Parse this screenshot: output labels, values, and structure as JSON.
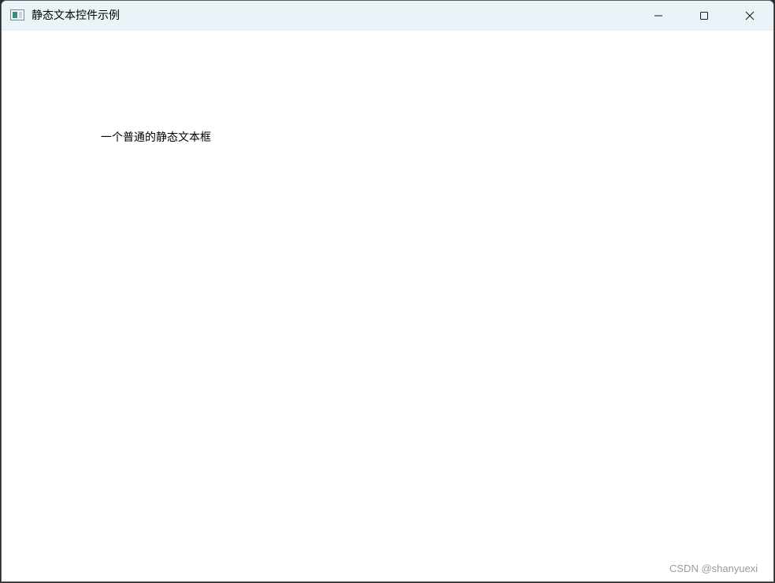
{
  "window": {
    "title": "静态文本控件示例",
    "icon": "app-window-icon",
    "controls": {
      "minimize_icon": "minimize-icon",
      "maximize_icon": "maximize-icon",
      "close_icon": "close-icon"
    }
  },
  "content": {
    "static_text": "一个普通的静态文本框"
  },
  "watermark": {
    "text": "CSDN @shanyuexi"
  },
  "colors": {
    "titlebar_bg": "#eaf3f7",
    "window_bg": "#ffffff",
    "text": "#000000",
    "watermark": "#9a9a9a"
  }
}
